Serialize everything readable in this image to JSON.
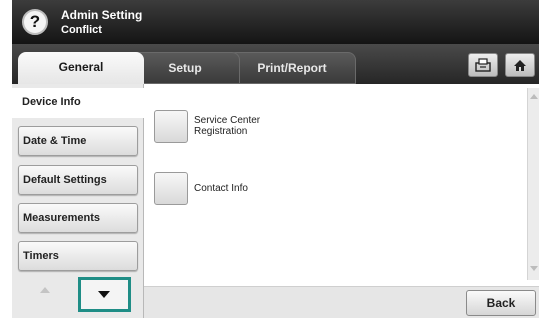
{
  "header": {
    "help_icon": "question-mark",
    "title": "Admin Setting",
    "subtitle": "Conflict"
  },
  "tabs": [
    {
      "label": "General",
      "active": true
    },
    {
      "label": "Setup",
      "active": false
    },
    {
      "label": "Print/Report",
      "active": false
    }
  ],
  "toolbar": {
    "job_status_icon": "job-status-icon",
    "home_icon": "home-icon"
  },
  "left_menu": [
    {
      "label": "Device Info",
      "active": true
    },
    {
      "label": "Date & Time",
      "active": false
    },
    {
      "label": "Default Settings",
      "active": false
    },
    {
      "label": "Measurements",
      "active": false
    },
    {
      "label": "Timers",
      "active": false
    }
  ],
  "content": {
    "options": [
      {
        "label_line1": "Service Center",
        "label_line2": "Registration"
      },
      {
        "label_line1": "Contact Info",
        "label_line2": ""
      }
    ]
  },
  "footer": {
    "back_label": "Back"
  },
  "colors": {
    "highlight_border": "#1f8d86",
    "header_bg": "#1e1e1e"
  }
}
